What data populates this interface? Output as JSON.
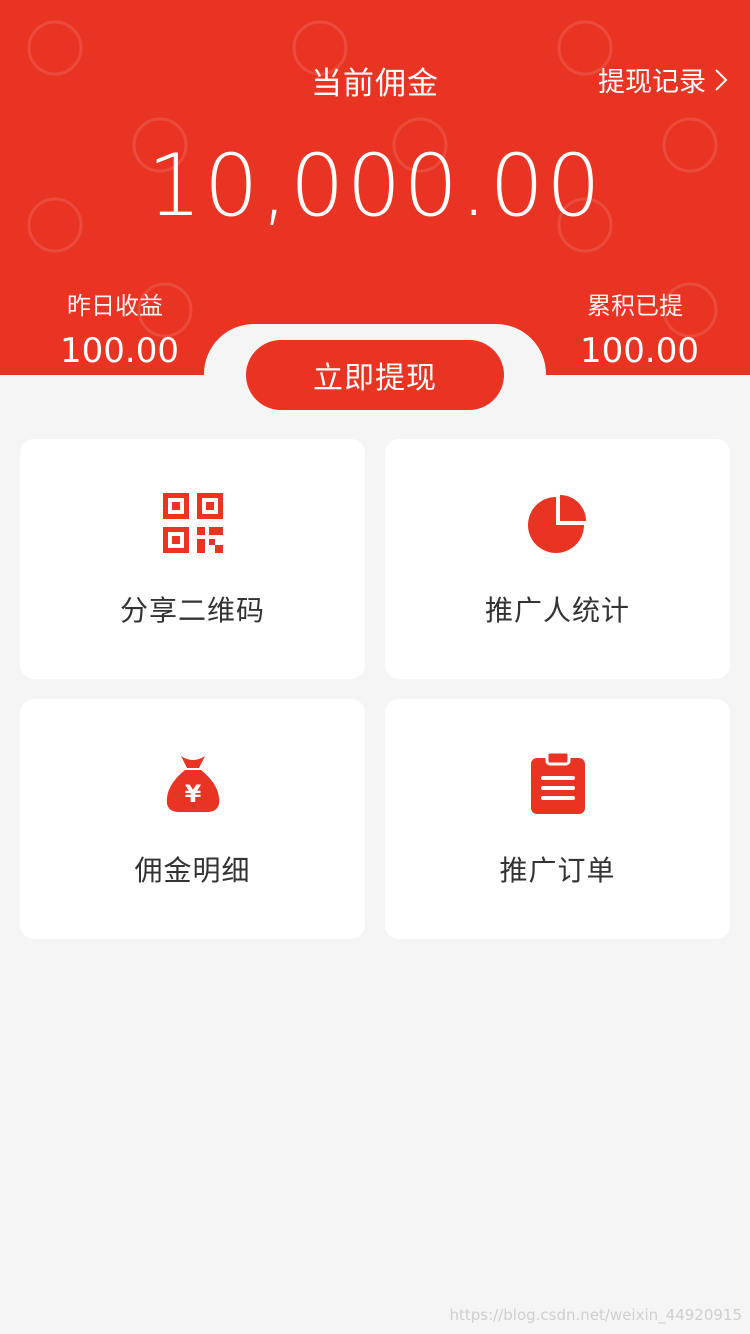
{
  "header": {
    "title": "当前佣金",
    "records_link": "提现记录",
    "amount": "10,000.00",
    "left_stat": {
      "label": "昨日收益",
      "value": "100.00"
    },
    "right_stat": {
      "label": "累积已提",
      "value": "100.00"
    },
    "withdraw_button": "立即提现"
  },
  "cards": [
    {
      "label": "分享二维码",
      "icon": "qr-code-icon"
    },
    {
      "label": "推广人统计",
      "icon": "pie-chart-icon"
    },
    {
      "label": "佣金明细",
      "icon": "money-bag-icon"
    },
    {
      "label": "推广订单",
      "icon": "clipboard-icon"
    }
  ],
  "footer": {
    "credit": "https://blog.csdn.net/weixin_44920915"
  },
  "colors": {
    "brand": "#e93323",
    "background": "#f5f5f5",
    "card_text": "#333333"
  }
}
